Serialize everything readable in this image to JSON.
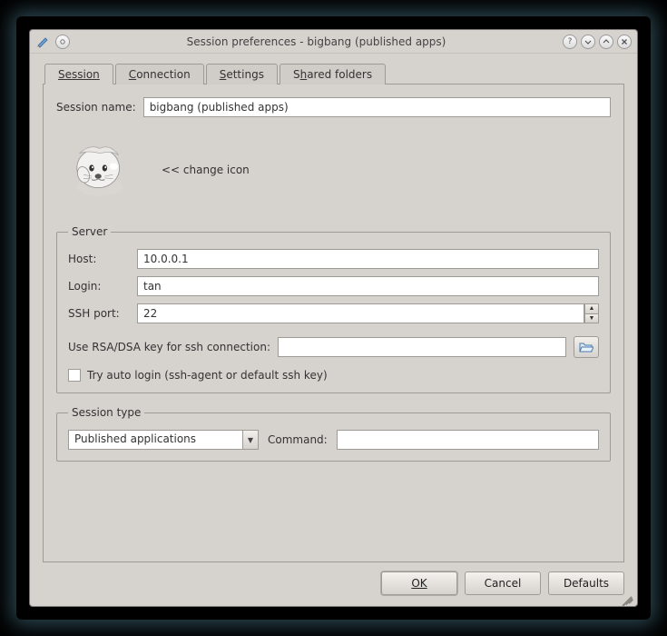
{
  "window": {
    "title": "Session preferences - bigbang (published apps)"
  },
  "tabs": {
    "session": "Session",
    "connection": "Connection",
    "settings": "Settings",
    "shared_folders": "Shared folders"
  },
  "session_name": {
    "label": "Session name:",
    "value": "bigbang (published apps)"
  },
  "change_icon_label": "<< change icon",
  "server": {
    "legend": "Server",
    "host_label": "Host:",
    "host_value": "10.0.0.1",
    "login_label": "Login:",
    "login_value": "tan",
    "ssh_port_label": "SSH port:",
    "ssh_port_value": "22",
    "rsa_label": "Use RSA/DSA key for ssh connection:",
    "rsa_value": "",
    "auto_login_label": "Try auto login (ssh-agent or default ssh key)"
  },
  "session_type": {
    "legend": "Session type",
    "selected": "Published applications",
    "command_label": "Command:",
    "command_value": ""
  },
  "buttons": {
    "ok": "OK",
    "cancel": "Cancel",
    "defaults": "Defaults"
  }
}
